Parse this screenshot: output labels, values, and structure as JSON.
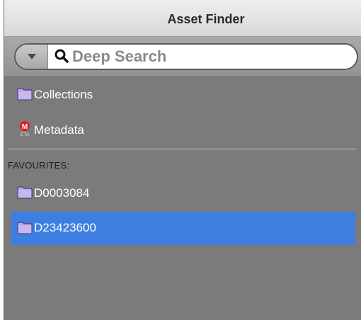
{
  "window": {
    "title": "Asset Finder"
  },
  "search": {
    "placeholder": "Deep Search",
    "value": ""
  },
  "nav": {
    "items": [
      {
        "label": "Collections",
        "icon": "folder-icon"
      },
      {
        "label": "Metadata",
        "icon": "metadata-icon"
      }
    ]
  },
  "favourites": {
    "header": "FAVOURITES:",
    "items": [
      {
        "label": "D0003084",
        "icon": "folder-icon",
        "selected": false
      },
      {
        "label": "D23423600",
        "icon": "folder-icon",
        "selected": true
      }
    ]
  },
  "colors": {
    "panel_bg": "#7b7b7b",
    "selection": "#3d7fe0",
    "folder": "#b9a6e8",
    "metadata_badge": "#e02020"
  }
}
